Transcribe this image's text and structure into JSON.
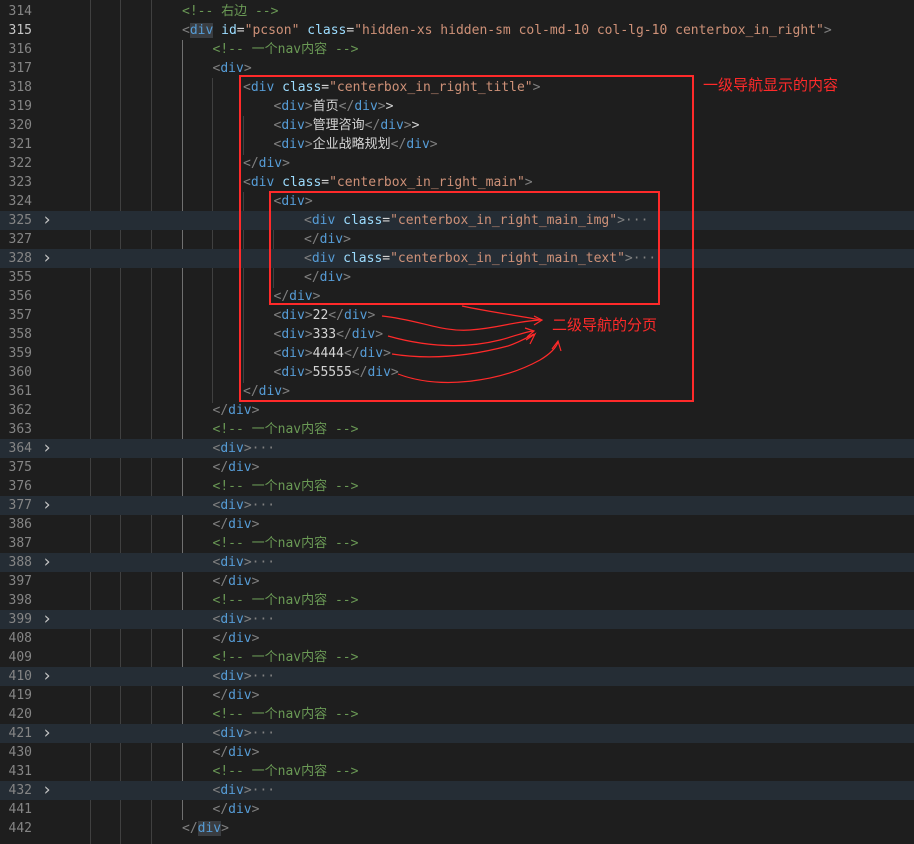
{
  "editor": {
    "lines": [
      {
        "n": "314",
        "i": 4,
        "fold": false,
        "folded": false,
        "t": [
          [
            "cmt",
            "<!-- 右边 -->"
          ]
        ]
      },
      {
        "n": "315",
        "i": 4,
        "fold": false,
        "folded": false,
        "active": true,
        "t": [
          [
            "br",
            "<"
          ],
          [
            "tag",
            "div",
            "hl"
          ],
          [
            "txt",
            " "
          ],
          [
            "attr",
            "id"
          ],
          [
            "eq",
            "="
          ],
          [
            "str",
            "\"pcson\""
          ],
          [
            "txt",
            " "
          ],
          [
            "attr",
            "class"
          ],
          [
            "eq",
            "="
          ],
          [
            "str",
            "\"hidden-xs hidden-sm col-md-10 col-lg-10 centerbox_in_right\""
          ],
          [
            "br",
            ">"
          ]
        ]
      },
      {
        "n": "316",
        "i": 5,
        "fold": false,
        "folded": false,
        "t": [
          [
            "cmt",
            "<!-- 一个nav内容 -->"
          ]
        ]
      },
      {
        "n": "317",
        "i": 5,
        "fold": false,
        "folded": false,
        "t": [
          [
            "br",
            "<"
          ],
          [
            "tag",
            "div"
          ],
          [
            "br",
            ">"
          ]
        ]
      },
      {
        "n": "318",
        "i": 6,
        "fold": false,
        "folded": false,
        "t": [
          [
            "br",
            "<"
          ],
          [
            "tag",
            "div"
          ],
          [
            "txt",
            " "
          ],
          [
            "attr",
            "class"
          ],
          [
            "eq",
            "="
          ],
          [
            "str",
            "\"centerbox_in_right_title\""
          ],
          [
            "br",
            ">"
          ]
        ]
      },
      {
        "n": "319",
        "i": 7,
        "fold": false,
        "folded": false,
        "t": [
          [
            "br",
            "<"
          ],
          [
            "tag",
            "div"
          ],
          [
            "br",
            ">"
          ],
          [
            "txt",
            "首页"
          ],
          [
            "br",
            "</"
          ],
          [
            "tag",
            "div"
          ],
          [
            "br",
            ">"
          ],
          [
            "txt",
            ">"
          ]
        ]
      },
      {
        "n": "320",
        "i": 7,
        "fold": false,
        "folded": false,
        "t": [
          [
            "br",
            "<"
          ],
          [
            "tag",
            "div"
          ],
          [
            "br",
            ">"
          ],
          [
            "txt",
            "管理咨询"
          ],
          [
            "br",
            "</"
          ],
          [
            "tag",
            "div"
          ],
          [
            "br",
            ">"
          ],
          [
            "txt",
            ">"
          ]
        ]
      },
      {
        "n": "321",
        "i": 7,
        "fold": false,
        "folded": false,
        "t": [
          [
            "br",
            "<"
          ],
          [
            "tag",
            "div"
          ],
          [
            "br",
            ">"
          ],
          [
            "txt",
            "企业战略规划"
          ],
          [
            "br",
            "</"
          ],
          [
            "tag",
            "div"
          ],
          [
            "br",
            ">"
          ]
        ]
      },
      {
        "n": "322",
        "i": 6,
        "fold": false,
        "folded": false,
        "t": [
          [
            "br",
            "</"
          ],
          [
            "tag",
            "div"
          ],
          [
            "br",
            ">"
          ]
        ]
      },
      {
        "n": "323",
        "i": 6,
        "fold": false,
        "folded": false,
        "t": [
          [
            "br",
            "<"
          ],
          [
            "tag",
            "div"
          ],
          [
            "txt",
            " "
          ],
          [
            "attr",
            "class"
          ],
          [
            "eq",
            "="
          ],
          [
            "str",
            "\"centerbox_in_right_main\""
          ],
          [
            "br",
            ">"
          ]
        ]
      },
      {
        "n": "324",
        "i": 7,
        "fold": false,
        "folded": false,
        "t": [
          [
            "br",
            "<"
          ],
          [
            "tag",
            "div"
          ],
          [
            "br",
            ">"
          ]
        ]
      },
      {
        "n": "325",
        "i": 8,
        "fold": true,
        "folded": true,
        "t": [
          [
            "br",
            "<"
          ],
          [
            "tag",
            "div"
          ],
          [
            "txt",
            " "
          ],
          [
            "attr",
            "class"
          ],
          [
            "eq",
            "="
          ],
          [
            "str",
            "\"centerbox_in_right_main_img\""
          ],
          [
            "br",
            ">"
          ],
          [
            "ell",
            "···"
          ]
        ]
      },
      {
        "n": "327",
        "i": 8,
        "fold": false,
        "folded": false,
        "t": [
          [
            "br",
            "</"
          ],
          [
            "tag",
            "div"
          ],
          [
            "br",
            ">"
          ]
        ]
      },
      {
        "n": "328",
        "i": 8,
        "fold": true,
        "folded": true,
        "t": [
          [
            "br",
            "<"
          ],
          [
            "tag",
            "div"
          ],
          [
            "txt",
            " "
          ],
          [
            "attr",
            "class"
          ],
          [
            "eq",
            "="
          ],
          [
            "str",
            "\"centerbox_in_right_main_text\""
          ],
          [
            "br",
            ">"
          ],
          [
            "ell",
            "···"
          ]
        ]
      },
      {
        "n": "355",
        "i": 8,
        "fold": false,
        "folded": false,
        "t": [
          [
            "br",
            "</"
          ],
          [
            "tag",
            "div"
          ],
          [
            "br",
            ">"
          ]
        ]
      },
      {
        "n": "356",
        "i": 7,
        "fold": false,
        "folded": false,
        "t": [
          [
            "br",
            "</"
          ],
          [
            "tag",
            "div"
          ],
          [
            "br",
            ">"
          ]
        ]
      },
      {
        "n": "357",
        "i": 7,
        "fold": false,
        "folded": false,
        "t": [
          [
            "br",
            "<"
          ],
          [
            "tag",
            "div"
          ],
          [
            "br",
            ">"
          ],
          [
            "txt",
            "22"
          ],
          [
            "br",
            "</"
          ],
          [
            "tag",
            "div"
          ],
          [
            "br",
            ">"
          ]
        ]
      },
      {
        "n": "358",
        "i": 7,
        "fold": false,
        "folded": false,
        "t": [
          [
            "br",
            "<"
          ],
          [
            "tag",
            "div"
          ],
          [
            "br",
            ">"
          ],
          [
            "txt",
            "333"
          ],
          [
            "br",
            "</"
          ],
          [
            "tag",
            "div"
          ],
          [
            "br",
            ">"
          ]
        ]
      },
      {
        "n": "359",
        "i": 7,
        "fold": false,
        "folded": false,
        "t": [
          [
            "br",
            "<"
          ],
          [
            "tag",
            "div"
          ],
          [
            "br",
            ">"
          ],
          [
            "txt",
            "4444"
          ],
          [
            "br",
            "</"
          ],
          [
            "tag",
            "div"
          ],
          [
            "br",
            ">"
          ]
        ]
      },
      {
        "n": "360",
        "i": 7,
        "fold": false,
        "folded": false,
        "t": [
          [
            "br",
            "<"
          ],
          [
            "tag",
            "div"
          ],
          [
            "br",
            ">"
          ],
          [
            "txt",
            "55555"
          ],
          [
            "br",
            "</"
          ],
          [
            "tag",
            "div"
          ],
          [
            "br",
            ">"
          ]
        ]
      },
      {
        "n": "361",
        "i": 6,
        "fold": false,
        "folded": false,
        "t": [
          [
            "br",
            "</"
          ],
          [
            "tag",
            "div"
          ],
          [
            "br",
            ">"
          ]
        ]
      },
      {
        "n": "362",
        "i": 5,
        "fold": false,
        "folded": false,
        "t": [
          [
            "br",
            "</"
          ],
          [
            "tag",
            "div"
          ],
          [
            "br",
            ">"
          ]
        ]
      },
      {
        "n": "363",
        "i": 5,
        "fold": false,
        "folded": false,
        "t": [
          [
            "cmt",
            "<!-- 一个nav内容 -->"
          ]
        ]
      },
      {
        "n": "364",
        "i": 5,
        "fold": true,
        "folded": true,
        "t": [
          [
            "br",
            "<"
          ],
          [
            "tag",
            "div"
          ],
          [
            "br",
            ">"
          ],
          [
            "ell",
            "···"
          ]
        ]
      },
      {
        "n": "375",
        "i": 5,
        "fold": false,
        "folded": false,
        "t": [
          [
            "br",
            "</"
          ],
          [
            "tag",
            "div"
          ],
          [
            "br",
            ">"
          ]
        ]
      },
      {
        "n": "376",
        "i": 5,
        "fold": false,
        "folded": false,
        "t": [
          [
            "cmt",
            "<!-- 一个nav内容 -->"
          ]
        ]
      },
      {
        "n": "377",
        "i": 5,
        "fold": true,
        "folded": true,
        "t": [
          [
            "br",
            "<"
          ],
          [
            "tag",
            "div"
          ],
          [
            "br",
            ">"
          ],
          [
            "ell",
            "···"
          ]
        ]
      },
      {
        "n": "386",
        "i": 5,
        "fold": false,
        "folded": false,
        "t": [
          [
            "br",
            "</"
          ],
          [
            "tag",
            "div"
          ],
          [
            "br",
            ">"
          ]
        ]
      },
      {
        "n": "387",
        "i": 5,
        "fold": false,
        "folded": false,
        "t": [
          [
            "cmt",
            "<!-- 一个nav内容 -->"
          ]
        ]
      },
      {
        "n": "388",
        "i": 5,
        "fold": true,
        "folded": true,
        "t": [
          [
            "br",
            "<"
          ],
          [
            "tag",
            "div"
          ],
          [
            "br",
            ">"
          ],
          [
            "ell",
            "···"
          ]
        ]
      },
      {
        "n": "397",
        "i": 5,
        "fold": false,
        "folded": false,
        "t": [
          [
            "br",
            "</"
          ],
          [
            "tag",
            "div"
          ],
          [
            "br",
            ">"
          ]
        ]
      },
      {
        "n": "398",
        "i": 5,
        "fold": false,
        "folded": false,
        "t": [
          [
            "cmt",
            "<!-- 一个nav内容 -->"
          ]
        ]
      },
      {
        "n": "399",
        "i": 5,
        "fold": true,
        "folded": true,
        "t": [
          [
            "br",
            "<"
          ],
          [
            "tag",
            "div"
          ],
          [
            "br",
            ">"
          ],
          [
            "ell",
            "···"
          ]
        ]
      },
      {
        "n": "408",
        "i": 5,
        "fold": false,
        "folded": false,
        "t": [
          [
            "br",
            "</"
          ],
          [
            "tag",
            "div"
          ],
          [
            "br",
            ">"
          ]
        ]
      },
      {
        "n": "409",
        "i": 5,
        "fold": false,
        "folded": false,
        "t": [
          [
            "cmt",
            "<!-- 一个nav内容 -->"
          ]
        ]
      },
      {
        "n": "410",
        "i": 5,
        "fold": true,
        "folded": true,
        "t": [
          [
            "br",
            "<"
          ],
          [
            "tag",
            "div"
          ],
          [
            "br",
            ">"
          ],
          [
            "ell",
            "···"
          ]
        ]
      },
      {
        "n": "419",
        "i": 5,
        "fold": false,
        "folded": false,
        "t": [
          [
            "br",
            "</"
          ],
          [
            "tag",
            "div"
          ],
          [
            "br",
            ">"
          ]
        ]
      },
      {
        "n": "420",
        "i": 5,
        "fold": false,
        "folded": false,
        "t": [
          [
            "cmt",
            "<!-- 一个nav内容 -->"
          ]
        ]
      },
      {
        "n": "421",
        "i": 5,
        "fold": true,
        "folded": true,
        "t": [
          [
            "br",
            "<"
          ],
          [
            "tag",
            "div"
          ],
          [
            "br",
            ">"
          ],
          [
            "ell",
            "···"
          ]
        ]
      },
      {
        "n": "430",
        "i": 5,
        "fold": false,
        "folded": false,
        "t": [
          [
            "br",
            "</"
          ],
          [
            "tag",
            "div"
          ],
          [
            "br",
            ">"
          ]
        ]
      },
      {
        "n": "431",
        "i": 5,
        "fold": false,
        "folded": false,
        "t": [
          [
            "cmt",
            "<!-- 一个nav内容 -->"
          ]
        ]
      },
      {
        "n": "432",
        "i": 5,
        "fold": true,
        "folded": true,
        "t": [
          [
            "br",
            "<"
          ],
          [
            "tag",
            "div"
          ],
          [
            "br",
            ">"
          ],
          [
            "ell",
            "···"
          ]
        ]
      },
      {
        "n": "441",
        "i": 5,
        "fold": false,
        "folded": false,
        "t": [
          [
            "br",
            "</"
          ],
          [
            "tag",
            "div"
          ],
          [
            "br",
            ">"
          ]
        ]
      },
      {
        "n": "442",
        "i": 4,
        "fold": false,
        "folded": false,
        "t": [
          [
            "br",
            "</"
          ],
          [
            "tag",
            "div",
            "hl"
          ],
          [
            "br",
            ">"
          ]
        ]
      }
    ]
  },
  "annotations": {
    "label_level1": "一级导航显示的内容",
    "label_level2": "二级导航的分页",
    "color": "#ff2a2a"
  },
  "theme": {
    "background": "#1e1e1e",
    "folded_line_bg": "#252d35",
    "line_number": "#858585",
    "tag": "#569cd6",
    "attr": "#9cdcfe",
    "string": "#ce9178",
    "comment": "#6a9955",
    "bracket": "#808080"
  }
}
